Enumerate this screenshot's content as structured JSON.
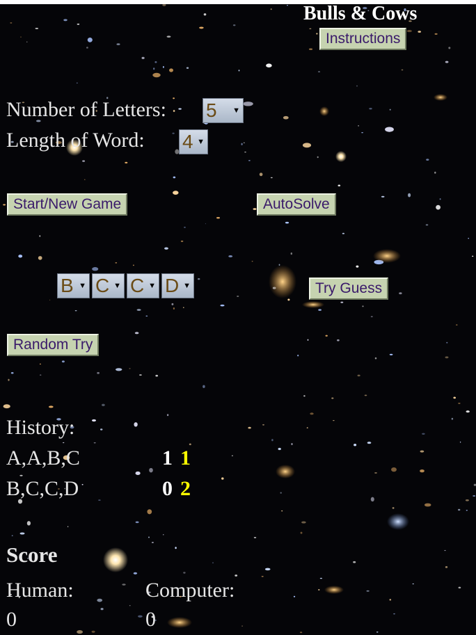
{
  "title": "Bulls & Cows",
  "buttons": {
    "instructions": "Instructions",
    "start": "Start/New Game",
    "autosolve": "AutoSolve",
    "try_guess": "Try Guess",
    "random_try": "Random Try"
  },
  "settings": {
    "letters_label": "Number of Letters:",
    "letters_value": "5",
    "length_label": "Length of Word:",
    "length_value": "4"
  },
  "guess": [
    "B",
    "C",
    "C",
    "D"
  ],
  "history": {
    "label": "History:",
    "rows": [
      {
        "word": "A,A,B,C",
        "bulls": "1",
        "cows": "1"
      },
      {
        "word": "B,C,C,D",
        "bulls": "0",
        "cows": "2"
      }
    ]
  },
  "score": {
    "title": "Score",
    "human_label": "Human:",
    "human_value": "0",
    "computer_label": "Computer:",
    "computer_value": "0"
  },
  "colors": {
    "background": "#050508",
    "button_bg": "#c6d3b0",
    "button_text": "#3a1a6a",
    "bulls": "#ffffff",
    "cows": "#ffff00"
  }
}
